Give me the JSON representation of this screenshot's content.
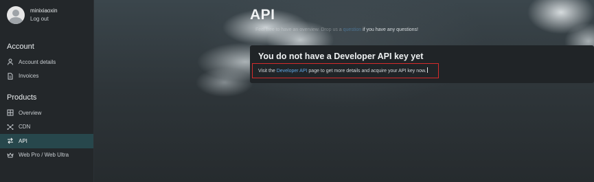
{
  "user": {
    "name": "minixiaoxin",
    "logout_label": "Log out"
  },
  "sidebar": {
    "account": {
      "title": "Account",
      "items": [
        {
          "label": "Account details",
          "icon": "person-icon"
        },
        {
          "label": "Invoices",
          "icon": "document-icon"
        }
      ]
    },
    "products": {
      "title": "Products",
      "items": [
        {
          "label": "Overview",
          "icon": "grid-icon"
        },
        {
          "label": "CDN",
          "icon": "network-icon"
        },
        {
          "label": "API",
          "icon": "swap-arrows-icon",
          "active": true
        },
        {
          "label": "Web Pro / Web Ultra",
          "icon": "crown-icon"
        }
      ]
    }
  },
  "main": {
    "title": "API",
    "intro": {
      "faded_text": "Feel free to have an overview. Drop us a",
      "link_text": "question",
      "tail_text": "if you have any questions!"
    },
    "card": {
      "title": "You do not have a Developer API key yet",
      "text_before": "Visit the ",
      "link_text": "Developer API",
      "text_after": " page to get more details and acquire your API key now."
    }
  },
  "colors": {
    "accent_link": "#5fa8e6",
    "active_nav": "#27474c",
    "highlight_box": "#d62b2b"
  }
}
